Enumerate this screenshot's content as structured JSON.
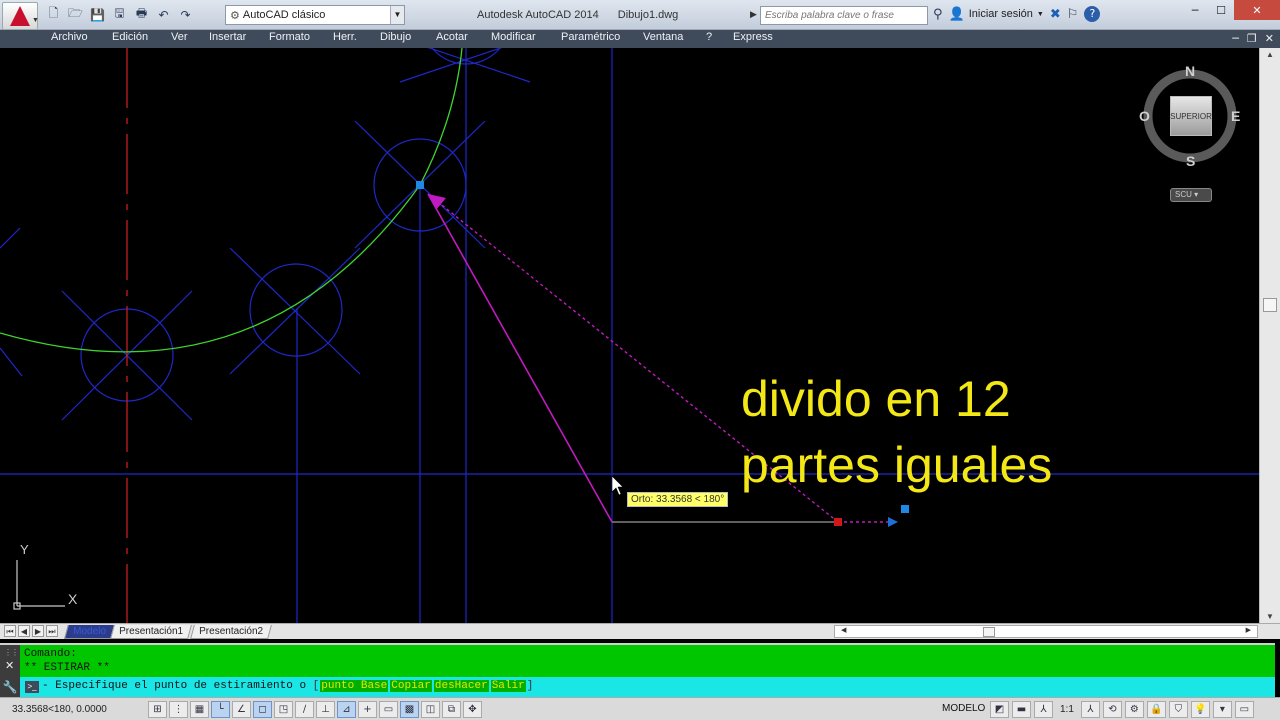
{
  "title_bar": {
    "workspace": "AutoCAD clásico",
    "app_name": "Autodesk AutoCAD 2014",
    "document_name": "Dibujo1.dwg",
    "search_placeholder": "Escriba palabra clave o frase",
    "sign_in": "Iniciar sesión",
    "help": "?"
  },
  "menu": [
    "Archivo",
    "Edición",
    "Ver",
    "Insertar",
    "Formato",
    "Herr.",
    "Dibujo",
    "Acotar",
    "Modificar",
    "Paramétrico",
    "Ventana",
    "?",
    "Express"
  ],
  "canvas": {
    "annotation_line1": "divido en 12",
    "annotation_line2": "partes iguales",
    "tooltip": "Orto: 33.3568 < 180°",
    "viewcube_face": "SUPERIOR",
    "compass": {
      "n": "N",
      "s": "S",
      "e": "E",
      "o": "O"
    },
    "ucs_menu": "SCU",
    "ucs_x": "X",
    "ucs_y": "Y",
    "colors": {
      "green_arc": "#3fd52e",
      "blue_line": "#1f28c8",
      "red_center": "#c42020",
      "magenta": "#c01bc0",
      "annotation": "#f3e816"
    }
  },
  "tabs": [
    "Modelo",
    "Presentación1",
    "Presentación2"
  ],
  "command": {
    "history_line1": "Comando:",
    "history_line2": "** ESTIRAR **",
    "prompt": "Especifique el punto de estiramiento o",
    "options": [
      "punto Base",
      "Copiar",
      "desHacer",
      "Salir"
    ]
  },
  "status": {
    "coords": "33.3568<180, 0.0000",
    "space": "MODELO",
    "scale": "1:1"
  }
}
